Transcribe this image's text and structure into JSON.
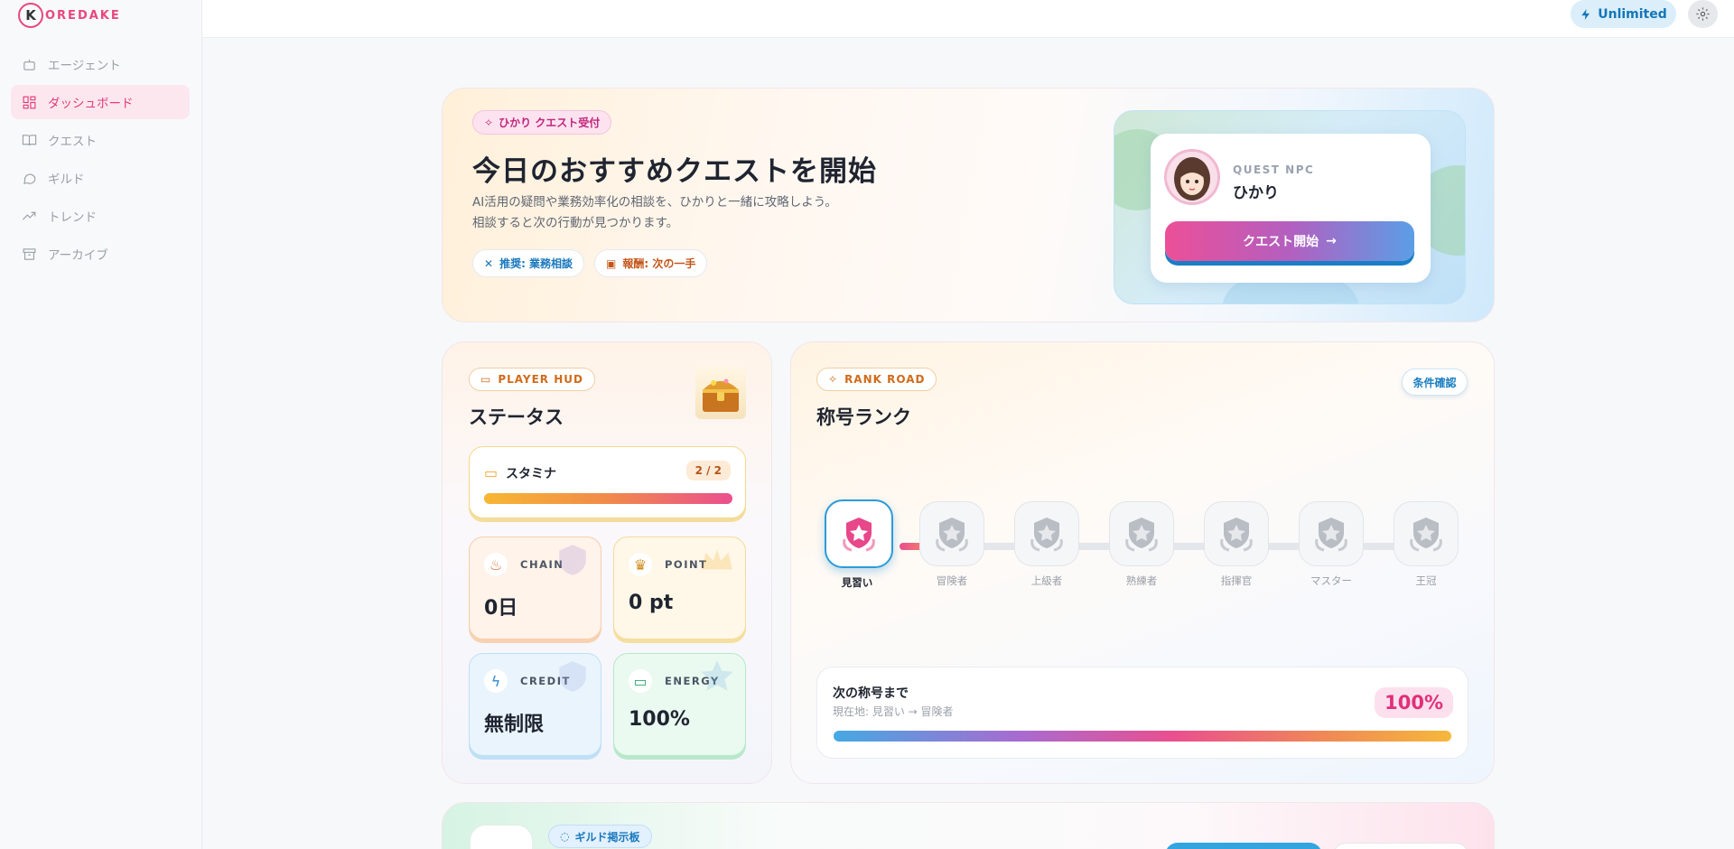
{
  "brand": {
    "logo_letter": "K",
    "logo_text": "OREDAKE"
  },
  "sidebar": {
    "items": [
      {
        "label": "エージェント",
        "icon": "bot-icon",
        "active": false
      },
      {
        "label": "ダッシュボード",
        "icon": "dashboard-icon",
        "active": true
      },
      {
        "label": "クエスト",
        "icon": "book-icon",
        "active": false
      },
      {
        "label": "ギルド",
        "icon": "chat-icon",
        "active": false
      },
      {
        "label": "トレンド",
        "icon": "trend-icon",
        "active": false
      },
      {
        "label": "アーカイブ",
        "icon": "archive-icon",
        "active": false
      }
    ]
  },
  "topbar": {
    "plan_label": "Unlimited",
    "settings_icon": "gear-icon"
  },
  "hero": {
    "badge": "ひかり クエスト受付",
    "title": "今日のおすすめクエストを開始",
    "description_line1": "AI活用の疑問や業務効率化の相談を、ひかりと一緒に攻略しよう。",
    "description_line2": "相談すると次の行動が見つかります。",
    "chip_recommend": "推奨: 業務相談",
    "chip_reward": "報酬: 次の一手",
    "npc_label": "QUEST NPC",
    "npc_name": "ひかり",
    "start_button": "クエスト開始",
    "start_arrow": "→"
  },
  "status": {
    "badge": "PLAYER HUD",
    "title": "ステータス",
    "stamina_label": "スタミナ",
    "stamina_value": "2 / 2",
    "stamina_fraction": 1.0,
    "tiles": [
      {
        "label": "CHAIN",
        "value": "0日",
        "icon": "flame-icon"
      },
      {
        "label": "POINT",
        "value": "0 pt",
        "icon": "trophy-icon"
      },
      {
        "label": "CREDIT",
        "value": "無制限",
        "icon": "bolt-icon"
      },
      {
        "label": "ENERGY",
        "value": "100%",
        "icon": "battery-icon"
      }
    ]
  },
  "rank": {
    "badge": "RANK ROAD",
    "title": "称号ランク",
    "condition_button": "条件確認",
    "ranks": [
      "見習い",
      "冒険者",
      "上級者",
      "熟練者",
      "指揮官",
      "マスター",
      "王冠"
    ],
    "current_index": 0,
    "next_title": "次の称号まで",
    "next_sub": "現在地: 見習い → 冒険者",
    "next_percent": "100%"
  },
  "guild": {
    "badge": "ギルド掲示板"
  },
  "colors": {
    "accent_pink": "#e8477e",
    "accent_blue": "#2d9bd8",
    "accent_orange": "#d06b1c"
  }
}
